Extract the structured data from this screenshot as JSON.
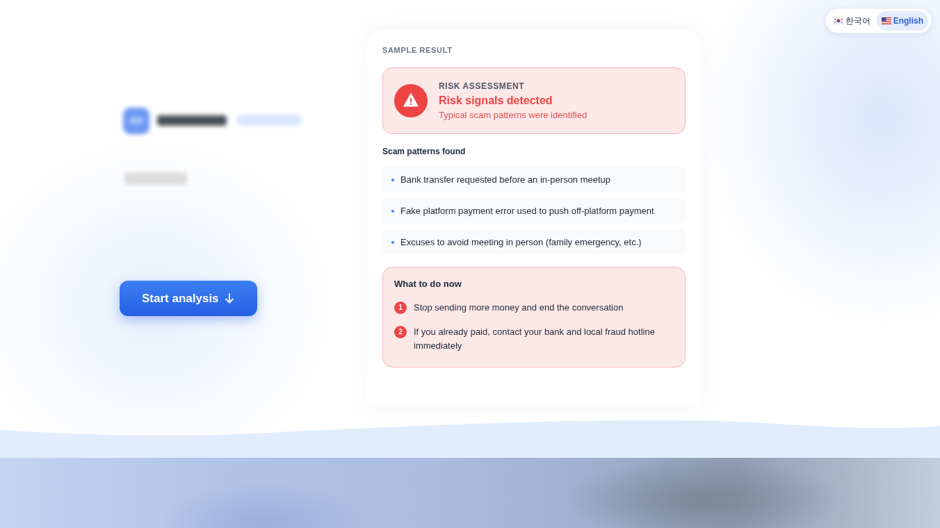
{
  "language_switcher": {
    "options": [
      {
        "kind": "kr",
        "label": "한국어",
        "selected": false
      },
      {
        "kind": "us",
        "label": "English",
        "selected": true
      }
    ]
  },
  "hero": {
    "button": "Start analysis"
  },
  "sample_result": {
    "label": "SAMPLE RESULT",
    "assessment": {
      "kind": "danger",
      "eyebrow": "RISK ASSESSMENT",
      "title": "Risk signals detected",
      "subtitle": "Typical scam patterns were identified"
    },
    "patterns": {
      "heading": "Scam patterns found",
      "items": [
        "Bank transfer requested before an in-person meetup",
        "Fake platform payment error used to push off-platform payment",
        "Excuses to avoid meeting in person (family emergency, etc.)"
      ]
    },
    "actions": {
      "heading": "What to do now",
      "steps": [
        {
          "number": "1",
          "text": "Stop sending more money and end the conversation"
        },
        {
          "number": "2",
          "text": "If you already paid, contact your bank and local fraud hotline immediately"
        }
      ]
    }
  }
}
